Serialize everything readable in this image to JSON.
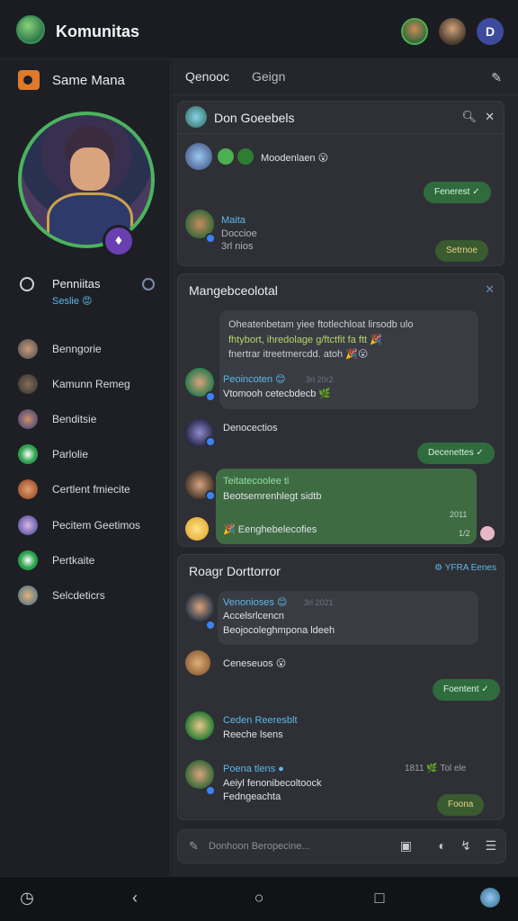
{
  "app": {
    "title": "Komunitas"
  },
  "sidebar": {
    "header_label": "Same Mana",
    "status_label": "Penniitas",
    "status_sub": "Seslie 😡",
    "friends": [
      "Benngorie",
      "Kamunn Remeg",
      "Benditsie",
      "Parlolie",
      "Certlent fmiecite",
      "Pecitem Geetimos",
      "Pertkaite",
      "Selcdeticrs"
    ]
  },
  "main": {
    "tabs": [
      "Qenooc",
      "Geign"
    ],
    "card1": {
      "title": "Don Goeebels",
      "msg1_text": "Moodenlaen 😮",
      "reply1": "Fenerest ✓",
      "msg2_name": "Maita",
      "msg2_line1": "Doccioe",
      "msg2_line2": "3rl nios",
      "reply2": "Setrnoe"
    },
    "card2": {
      "title": "Mangebceolotal",
      "bubble_line1": "Oheatenbetam yiee ftotlechloat lirsodb ulo",
      "bubble_line2": "fhtybort, ihredolage g/ftctfit fa ftt 🎉",
      "bubble_line3": "fnertrar itreetmercdd. atoh 🎉😮",
      "msg1_name": "Peoincoten 😊",
      "msg1_time": "3rl 20r2",
      "msg1_text": "Vtomooh cetecbdecb 🌿",
      "msg2_text": "Denocectios",
      "reply1": "Decenettes ✓",
      "green_name": "Teitatecoolee ti",
      "green_text": "Beotsemrenhlegt sidtb",
      "green_time": "2011",
      "green_reactions": "🎉 Eenghebelecofies",
      "green_count": "1/2"
    },
    "card3": {
      "title": "Roagr Dorttorror",
      "head_right": "⚙ YFRA Eenes",
      "msg1_name": "Venonioses 😊",
      "msg1_time": "3rl 2021",
      "msg1_line1": "Accelsrlcencn",
      "msg1_line2": "Beojocoleghmpona ldeeh",
      "msg2_text": "Ceneseuos 😮",
      "reply1": "Foentent ✓",
      "msg3_name": "Ceden Reeresblt",
      "msg3_text": "Reeche lsens",
      "msg4_name": "Poena tlens ●",
      "msg4_line1": "Aeiyl fenonibecoltoock",
      "msg4_line2": "Fedngeachta",
      "msg4_right": "1811 🌿 Tol ele",
      "reply2": "Foona"
    },
    "composer_placeholder": "Donhoon Beropecine..."
  },
  "icons": [
    "search-icon",
    "close-icon",
    "pen-icon",
    "settings-icon",
    "clock-icon",
    "chat-icon",
    "back-icon",
    "home-icon",
    "recents-icon"
  ]
}
